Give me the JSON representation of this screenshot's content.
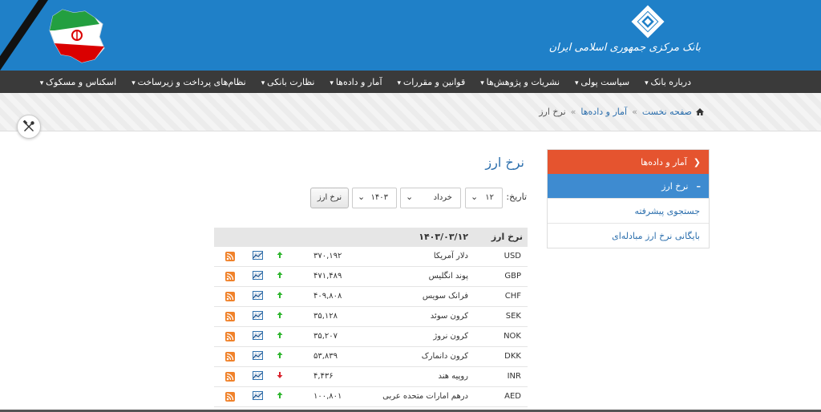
{
  "header": {
    "logo_text": "بانک مرکزی جمهوری اسلامی ایران"
  },
  "nav": {
    "items": [
      {
        "label": "درباره بانک"
      },
      {
        "label": "سیاست پولی"
      },
      {
        "label": "نشریات و پژوهش‌ها"
      },
      {
        "label": "قوانین و مقررات"
      },
      {
        "label": "آمار و داده‌ها"
      },
      {
        "label": "نظارت بانکی"
      },
      {
        "label": "نظام‌های پرداخت و زیرساخت"
      },
      {
        "label": "اسکناس و مسکوک"
      }
    ]
  },
  "breadcrumb": {
    "home": "صفحه نخست",
    "section": "آمار و داده‌ها",
    "current": "نرخ ارز",
    "separator": "»"
  },
  "sidebar": {
    "header": "آمار و داده‌ها",
    "active": "نرخ ارز",
    "links": [
      {
        "label": "جستجوی پیشرفته"
      },
      {
        "label": "بایگانی نرخ ارز مبادله‌ای"
      }
    ]
  },
  "main": {
    "title": "نرخ ارز",
    "filter": {
      "label": "تاریخ:",
      "day": "۱۲",
      "month": "خرداد",
      "year": "۱۴۰۳",
      "submit": "نرخ ارز"
    },
    "table": {
      "header_name": "نرخ ارز",
      "header_date": "۱۴۰۳/۰۳/۱۲",
      "rows": [
        {
          "code": "USD",
          "name": "دلار آمریکا",
          "rate": "۳۷۰,۱۹۲",
          "trend": "up"
        },
        {
          "code": "GBP",
          "name": "پوند انگلیس",
          "rate": "۴۷۱,۴۸۹",
          "trend": "up"
        },
        {
          "code": "CHF",
          "name": "فرانک سویس",
          "rate": "۴۰۹,۸۰۸",
          "trend": "up"
        },
        {
          "code": "SEK",
          "name": "کرون سوئد",
          "rate": "۳۵,۱۲۸",
          "trend": "up"
        },
        {
          "code": "NOK",
          "name": "کرون نروژ",
          "rate": "۳۵,۲۰۷",
          "trend": "up"
        },
        {
          "code": "DKK",
          "name": "کرون دانمارک",
          "rate": "۵۳,۸۳۹",
          "trend": "up"
        },
        {
          "code": "INR",
          "name": "روپیه هند",
          "rate": "۴,۴۳۶",
          "trend": "down"
        },
        {
          "code": "AED",
          "name": "درهم امارات متحده عربی",
          "rate": "۱۰۰,۸۰۱",
          "trend": "up"
        }
      ]
    }
  },
  "colors": {
    "header_blue": "#1f80c8",
    "nav_dark": "#3a3a3a",
    "sidebar_orange": "#e5542f",
    "sidebar_active_blue": "#3e8bd0",
    "trend_up": "#2fb52f",
    "trend_down": "#d9232d",
    "rss_orange": "#f0822b"
  },
  "icons": {
    "tools": "tools-icon",
    "home": "home-icon",
    "chart": "chart-icon",
    "rss": "rss-icon"
  }
}
